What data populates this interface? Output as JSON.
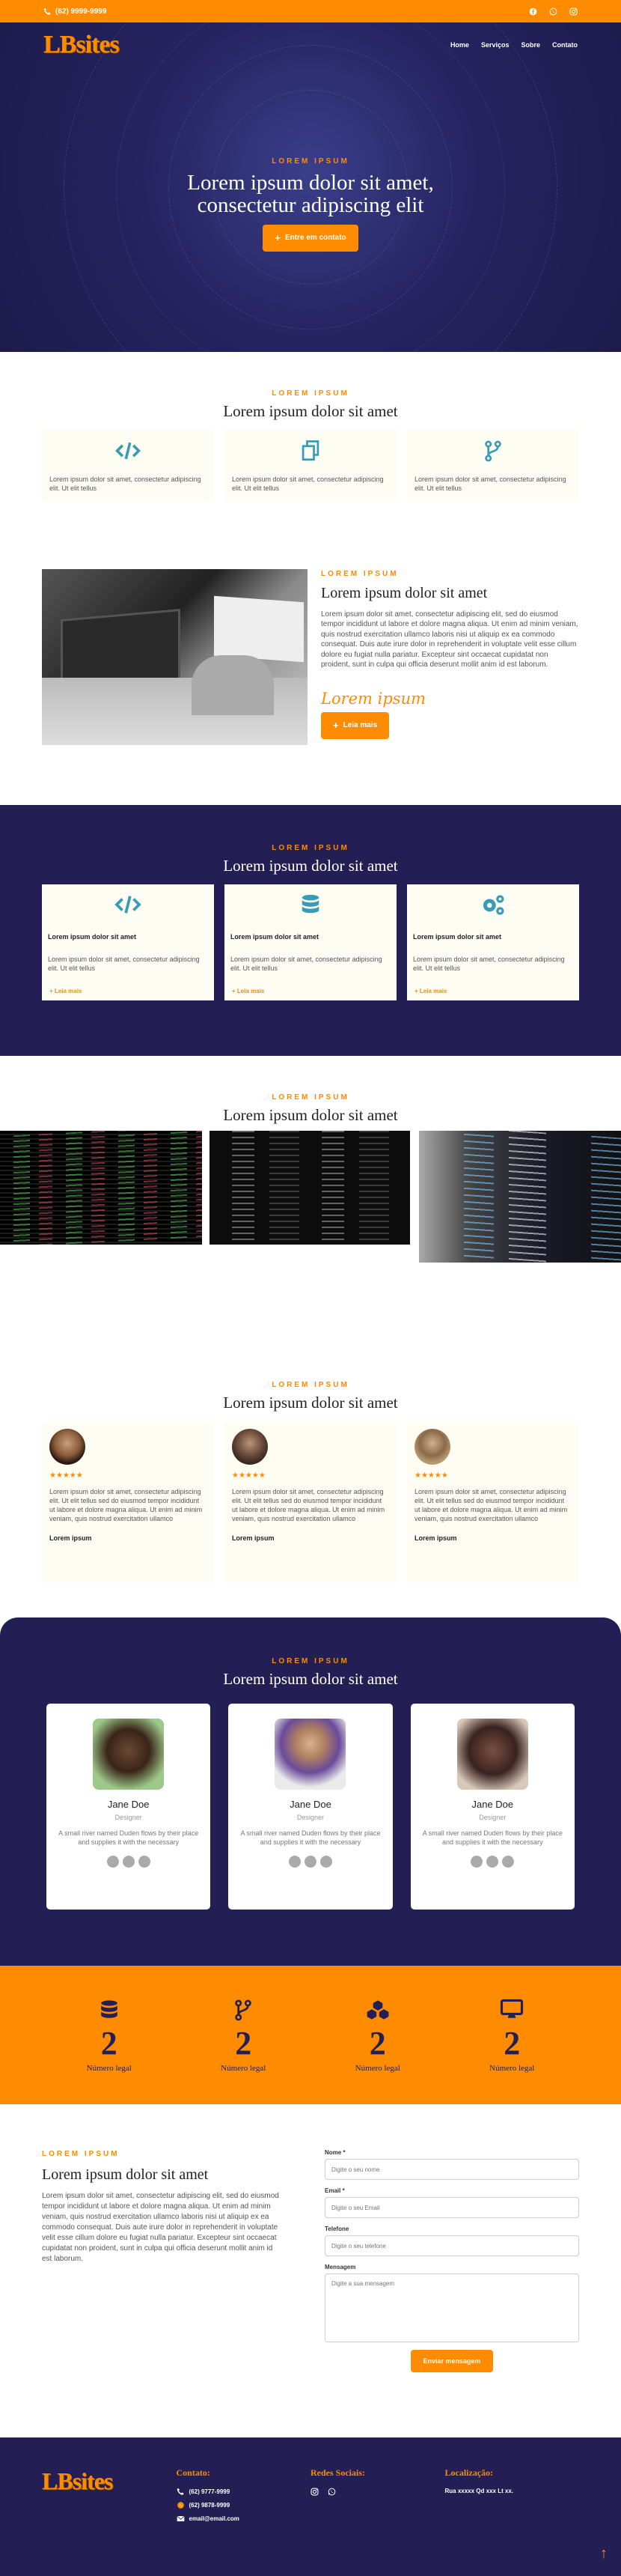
{
  "colors": {
    "accent": "#ff8c00",
    "dark": "#231f55"
  },
  "topbar": {
    "phone": "(62) 9999-9999",
    "social_icons": [
      "facebook-icon",
      "whatsapp-icon",
      "instagram-icon"
    ]
  },
  "nav": {
    "logo": "LBsites",
    "items": [
      "Home",
      "Serviços",
      "Sobre",
      "Contato"
    ]
  },
  "hero": {
    "kicker": "LOREM IPSUM",
    "title_line1": "Lorem ipsum dolor sit amet,",
    "title_line2": "consectetur adipiscing elit",
    "button": "Entre em contato"
  },
  "features": {
    "kicker": "LOREM IPSUM",
    "title": "Lorem ipsum dolor sit amet",
    "cards": [
      {
        "icon": "code-icon",
        "text": "Lorem ipsum dolor sit amet, consectetur adipiscing elit. Ut elit tellus"
      },
      {
        "icon": "copy-icon",
        "text": "Lorem ipsum dolor sit amet, consectetur adipiscing elit. Ut elit tellus"
      },
      {
        "icon": "branch-icon",
        "text": "Lorem ipsum dolor sit amet, consectetur adipiscing elit. Ut elit tellus"
      }
    ]
  },
  "about": {
    "kicker": "LOREM IPSUM",
    "title": "Lorem ipsum dolor sit amet",
    "text": "Lorem ipsum dolor sit amet, consectetur adipiscing elit, sed do eiusmod tempor incididunt ut labore et dolore magna aliqua. Ut enim ad minim veniam, quis nostrud exercitation ullamco laboris nisi ut aliquip ex ea commodo consequat. Duis aute irure dolor in reprehenderit in voluptate velit esse cillum dolore eu fugiat nulla pariatur. Excepteur sint occaecat cupidatat non proident, sunt in culpa qui officia deserunt mollit anim id est laborum.",
    "script": "Lorem ipsum",
    "button": "Leia mais"
  },
  "services": {
    "kicker": "LOREM IPSUM",
    "title": "Lorem ipsum dolor sit amet",
    "cards": [
      {
        "icon": "code-icon",
        "heading": "Lorem ipsum dolor sit amet",
        "text": "Lorem ipsum dolor sit amet, consectetur adipiscing elit. Ut elit tellus",
        "more": "Leia mais"
      },
      {
        "icon": "database-icon",
        "heading": "Lorem ipsum dolor sit amet",
        "text": "Lorem ipsum dolor sit amet, consectetur adipiscing elit. Ut elit tellus",
        "more": "Leia mais"
      },
      {
        "icon": "gears-icon",
        "heading": "Lorem ipsum dolor sit amet",
        "text": "Lorem ipsum dolor sit amet, consectetur adipiscing elit. Ut elit tellus",
        "more": "Leia mais"
      }
    ]
  },
  "gallery": {
    "kicker": "LOREM IPSUM",
    "title": "Lorem ipsum dolor sit amet"
  },
  "testimonials": {
    "kicker": "LOREM IPSUM",
    "title": "Lorem ipsum dolor sit amet",
    "items": [
      {
        "stars": "★★★★★",
        "text": "Lorem ipsum dolor sit amet, consectetur adipiscing elit. Ut elit tellus sed do eiusmod tempor incididunt ut labore et dolore magna aliqua. Ut enim ad minim veniam, quis nostrud exercitation ullamco",
        "name": "Lorem ipsum"
      },
      {
        "stars": "★★★★★",
        "text": "Lorem ipsum dolor sit amet, consectetur adipiscing elit. Ut elit tellus sed do eiusmod tempor incididunt ut labore et dolore magna aliqua. Ut enim ad minim veniam, quis nostrud exercitation ullamco",
        "name": "Lorem ipsum"
      },
      {
        "stars": "★★★★★",
        "text": "Lorem ipsum dolor sit amet, consectetur adipiscing elit. Ut elit tellus sed do eiusmod tempor incididunt ut labore et dolore magna aliqua. Ut enim ad minim veniam, quis nostrud exercitation ullamco",
        "name": "Lorem ipsum"
      }
    ]
  },
  "team": {
    "kicker": "LOREM IPSUM",
    "title": "Lorem ipsum dolor sit amet",
    "members": [
      {
        "name": "Jane Doe",
        "role": "Designer",
        "text": "A small river named Duden flows by their place and supplies it with the necessary"
      },
      {
        "name": "Jane Doe",
        "role": "Designer",
        "text": "A small river named Duden flows by their place and supplies it with the necessary"
      },
      {
        "name": "Jane Doe",
        "role": "Designer",
        "text": "A small river named Duden flows by their place and supplies it with the necessary"
      }
    ]
  },
  "stats": [
    {
      "icon": "database-icon",
      "value": "2",
      "label": "Número legal"
    },
    {
      "icon": "branch-icon",
      "value": "2",
      "label": "Número legal"
    },
    {
      "icon": "cubes-icon",
      "value": "2",
      "label": "Número legal"
    },
    {
      "icon": "monitor-icon",
      "value": "2",
      "label": "Número legal"
    }
  ],
  "contact": {
    "kicker": "LOREM IPSUM",
    "title": "Lorem ipsum dolor sit amet",
    "text": "Lorem ipsum dolor sit amet, consectetur adipiscing elit, sed do eiusmod tempor incididunt ut labore et dolore magna aliqua. Ut enim ad minim veniam, quis nostrud exercitation ullamco laboris nisi ut aliquip ex ea commodo consequat. Duis aute irure dolor in reprehenderit in voluptate velit esse cillum dolore eu fugiat nulla pariatur. Excepteur sint occaecat cupidatat non proident, sunt in culpa qui officia deserunt mollit anim id est laborum.",
    "form": {
      "name_label": "Nome *",
      "name_placeholder": "Digite o seu nome",
      "email_label": "Email *",
      "email_placeholder": "Digite o seu Email",
      "phone_label": "Telefone",
      "phone_placeholder": "Digite o seu telefone",
      "msg_label": "Mensagem",
      "msg_placeholder": "Digite a sua mensagem",
      "submit": "Enviar mensagem"
    }
  },
  "footer": {
    "logo": "LBsites",
    "contact_title": "Contato:",
    "phones": [
      "(62) 9777-9999",
      "(62) 9878-9999"
    ],
    "email": "email@email.com",
    "social_title": "Redes Sociais:",
    "location_title": "Localização:",
    "address": "Rua xxxxx Qd xxx Lt xx."
  }
}
